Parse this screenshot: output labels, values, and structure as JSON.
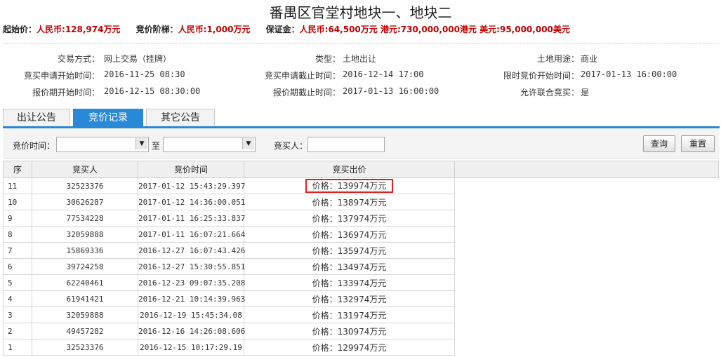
{
  "page_title": "番禺区官堂村地块一、地块二",
  "price_bar": {
    "start_label": "起始价：",
    "start_value": "人民币:128,974万元",
    "step_label": "竞价阶梯：",
    "step_value": "人民币:1,000万元",
    "deposit_label": "保证金：",
    "deposit_value": "人民币:64,500万元 港元:730,000,000港元 美元:95,000,000美元"
  },
  "info": {
    "trade_mode_label": "交易方式：",
    "trade_mode": "网上交易（挂牌）",
    "type_label": "类型：",
    "type": "土地出让",
    "land_use_label": "土地用途：",
    "land_use": "商业",
    "apply_start_label": "竞买申请开始时间：",
    "apply_start": "2016-11-25 08:30",
    "apply_end_label": "竞买申请截止时间：",
    "apply_end": "2016-12-14 17:00",
    "timed_bid_start_label": "限时竞价开始时间：",
    "timed_bid_start": "2017-01-13 16:00:00",
    "quote_start_label": "报价期开始时间：",
    "quote_start": "2016-12-15 08:30:00",
    "quote_end_label": "报价期截止时间：",
    "quote_end": "2017-01-13 16:00:00",
    "joint_bid_label": "允许联合竞买：",
    "joint_bid": "是"
  },
  "tabs": [
    "出让公告",
    "竞价记录",
    "其它公告"
  ],
  "active_tab": 1,
  "filter": {
    "bid_time_label": "竞价时间：",
    "to_label": "至",
    "bidder_label": "竞买人：",
    "from_value": "",
    "to_value": "",
    "bidder_value": "",
    "search_btn": "查询",
    "reset_btn": "重置"
  },
  "table": {
    "headers": [
      "序",
      "竞买人",
      "竞价时间",
      "竞买出价"
    ],
    "price_prefix": "价格：",
    "rows": [
      {
        "seq": "11",
        "bidder": "32523376",
        "time": "2017-01-12 15:43:29.397",
        "price": "价格：139974万元"
      },
      {
        "seq": "10",
        "bidder": "30626287",
        "time": "2017-01-12 14:36:00.051",
        "price": "价格：138974万元"
      },
      {
        "seq": "9",
        "bidder": "77534228",
        "time": "2017-01-11 16:25:33.837",
        "price": "价格：137974万元"
      },
      {
        "seq": "8",
        "bidder": "32059888",
        "time": "2017-01-11 16:07:21.664",
        "price": "价格：136974万元"
      },
      {
        "seq": "7",
        "bidder": "15869336",
        "time": "2016-12-27 16:07:43.426",
        "price": "价格：135974万元"
      },
      {
        "seq": "6",
        "bidder": "39724258",
        "time": "2016-12-27 15:30:55.851",
        "price": "价格：134974万元"
      },
      {
        "seq": "5",
        "bidder": "62240461",
        "time": "2016-12-23 09:07:35.208",
        "price": "价格：133974万元"
      },
      {
        "seq": "4",
        "bidder": "61941421",
        "time": "2016-12-21 10:14:39.963",
        "price": "价格：132974万元"
      },
      {
        "seq": "3",
        "bidder": "32059888",
        "time": "2016-12-19 15:45:34.08",
        "price": "价格：131974万元"
      },
      {
        "seq": "2",
        "bidder": "49457282",
        "time": "2016-12-16 14:26:08.606",
        "price": "价格：130974万元"
      },
      {
        "seq": "1",
        "bidder": "32523376",
        "time": "2016-12-15 10:17:29.19",
        "price": "价格：129974万元"
      }
    ]
  },
  "colors": {
    "accent": "#2a88d9",
    "price_red": "#c00000",
    "highlight_box": "#e02020"
  }
}
